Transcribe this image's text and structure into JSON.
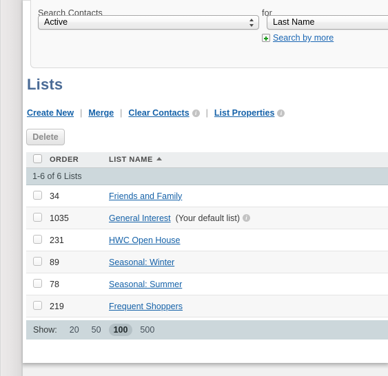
{
  "search_panel": {
    "contacts_label": "Search Contacts",
    "for_label": "for",
    "status_select": {
      "value": "Active"
    },
    "field_select": {
      "value": "Last Name"
    },
    "search_by_more": {
      "label": "Search by more",
      "icon": "plus-icon"
    }
  },
  "page": {
    "title": "Lists"
  },
  "actions": {
    "create_new": "Create New",
    "merge": "Merge",
    "clear_contacts": "Clear Contacts",
    "list_properties": "List Properties",
    "separator": "|",
    "info_glyph": "i"
  },
  "delete_button": {
    "label": "Delete"
  },
  "table": {
    "count_bar": "1-6 of 6 Lists",
    "columns": {
      "order": "ORDER",
      "list_name": "LIST NAME",
      "sort_indicator": "ascending"
    },
    "rows": [
      {
        "order": "34",
        "name": "Friends and Family",
        "note": ""
      },
      {
        "order": "1035",
        "name": "General Interest",
        "note": "(Your default list)",
        "has_info": true
      },
      {
        "order": "231",
        "name": "HWC Open House",
        "note": ""
      },
      {
        "order": "89",
        "name": "Seasonal: Winter",
        "note": ""
      },
      {
        "order": "78",
        "name": "Seasonal: Summer",
        "note": ""
      },
      {
        "order": "219",
        "name": "Frequent Shoppers",
        "note": ""
      }
    ]
  },
  "show_bar": {
    "label": "Show:",
    "options": [
      "20",
      "50",
      "100",
      "500"
    ],
    "selected": "100"
  },
  "colors": {
    "link": "#1461a8",
    "heading": "#4a6b96",
    "count_bar": "#cdd8dc",
    "show_bar": "#ccd7db",
    "plus_green": "#1f9e1f"
  }
}
